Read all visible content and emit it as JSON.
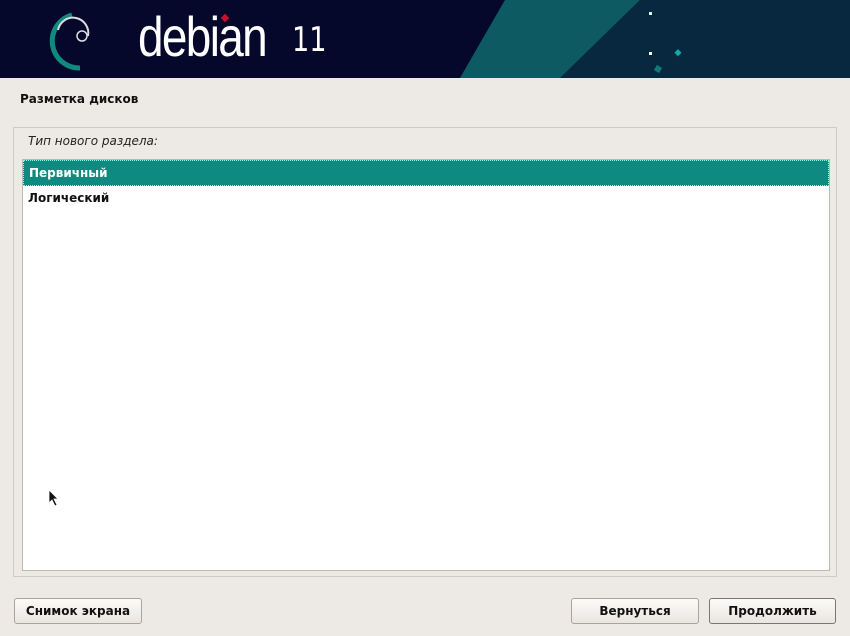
{
  "header": {
    "logo_text": "debian",
    "version": "11"
  },
  "page": {
    "title": "Разметка дисков",
    "prompt": "Тип нового раздела:"
  },
  "list": {
    "items": [
      {
        "label": "Первичный",
        "selected": true
      },
      {
        "label": "Логический",
        "selected": false
      }
    ]
  },
  "buttons": {
    "screenshot": "Снимок экрана",
    "back": "Вернуться",
    "continue": "Продолжить"
  },
  "colors": {
    "accent": "#0f8a80",
    "header_bg": "#05082a"
  }
}
